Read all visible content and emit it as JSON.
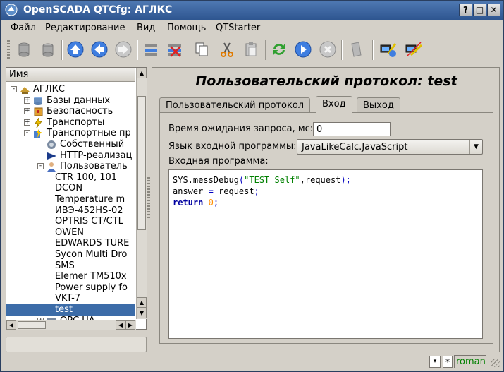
{
  "window": {
    "title": "OpenSCADA QTCfg: АГЛКС",
    "btn_help": "?",
    "btn_minimize": "_",
    "btn_maximize": "□",
    "btn_close": "✕"
  },
  "menu": [
    {
      "label": "Файл",
      "key": "F"
    },
    {
      "label": "Редактирование",
      "key": "Р"
    },
    {
      "label": "Вид",
      "key": "В"
    },
    {
      "label": "Помощь",
      "key": "П"
    },
    {
      "label": "QTStarter",
      "key": ""
    }
  ],
  "toolbar": {
    "icons": [
      "db-load-icon",
      "db-save-icon",
      "up-icon",
      "back-icon",
      "forward-icon",
      "add-item-icon",
      "delete-item-icon",
      "copy-icon",
      "cut-icon",
      "paste-icon",
      "refresh-icon",
      "start-icon",
      "stop-icon",
      "info-icon",
      "station-1-icon",
      "station-2-icon"
    ]
  },
  "tree": {
    "header": "Имя",
    "items": [
      {
        "label": "АГЛКС",
        "level": 0,
        "expander": "-",
        "icon": "station"
      },
      {
        "label": "Базы данных",
        "level": 1,
        "expander": "+",
        "icon": "db"
      },
      {
        "label": "Безопасность",
        "level": 1,
        "expander": "+",
        "icon": "security"
      },
      {
        "label": "Транспорты",
        "level": 1,
        "expander": "+",
        "icon": "transport"
      },
      {
        "label": "Транспортные пр",
        "level": 1,
        "expander": "-",
        "icon": "protocols"
      },
      {
        "label": "Собственный",
        "level": 2,
        "expander": "",
        "icon": "self"
      },
      {
        "label": "HTTP-реализац",
        "level": 2,
        "expander": "",
        "icon": "http"
      },
      {
        "label": "Пользователь",
        "level": 2,
        "expander": "-",
        "icon": "user"
      },
      {
        "label": "CTR 100, 101",
        "level": 3,
        "expander": "",
        "icon": ""
      },
      {
        "label": "DCON",
        "level": 3,
        "expander": "",
        "icon": ""
      },
      {
        "label": "Temperature m",
        "level": 3,
        "expander": "",
        "icon": ""
      },
      {
        "label": "ИВЭ-452HS-02",
        "level": 3,
        "expander": "",
        "icon": ""
      },
      {
        "label": "OPTRIS CT/CTL",
        "level": 3,
        "expander": "",
        "icon": ""
      },
      {
        "label": "OWEN",
        "level": 3,
        "expander": "",
        "icon": ""
      },
      {
        "label": "EDWARDS TURE",
        "level": 3,
        "expander": "",
        "icon": ""
      },
      {
        "label": "Sycon Multi Dro",
        "level": 3,
        "expander": "",
        "icon": ""
      },
      {
        "label": "SMS",
        "level": 3,
        "expander": "",
        "icon": ""
      },
      {
        "label": "Elemer TM510x",
        "level": 3,
        "expander": "",
        "icon": ""
      },
      {
        "label": "Power supply fo",
        "level": 3,
        "expander": "",
        "icon": ""
      },
      {
        "label": "VKT-7",
        "level": 3,
        "expander": "",
        "icon": ""
      },
      {
        "label": "test",
        "level": 3,
        "expander": "",
        "icon": "",
        "selected": true
      },
      {
        "label": "OPC UA",
        "level": 2,
        "expander": "+",
        "icon": "opc"
      }
    ]
  },
  "page": {
    "title": "Пользовательский протокол: test",
    "tabs": [
      {
        "label": "Пользовательский протокол",
        "active": false
      },
      {
        "label": "Вход",
        "active": true
      },
      {
        "label": "Выход",
        "active": false
      }
    ],
    "wait_label": "Время ожидания запроса, мс:",
    "wait_value": "0",
    "lang_label": "Язык входной программы:",
    "lang_value": "JavaLikeCalc.JavaScript",
    "program_label": "Входная программа:"
  },
  "program_code": [
    [
      {
        "t": "SYS.messDebug",
        "c": ""
      },
      {
        "t": "(",
        "c": "op"
      },
      {
        "t": "\"TEST Self\"",
        "c": "str"
      },
      {
        "t": ",request",
        "c": ""
      },
      {
        "t": ");",
        "c": "op"
      }
    ],
    [
      {
        "t": "answer ",
        "c": ""
      },
      {
        "t": "=",
        "c": "op"
      },
      {
        "t": " request",
        "c": ""
      },
      {
        "t": ";",
        "c": "op"
      }
    ],
    [
      {
        "t": "return",
        "c": "kw"
      },
      {
        "t": " ",
        "c": ""
      },
      {
        "t": "0",
        "c": "num"
      },
      {
        "t": ";",
        "c": "op"
      }
    ]
  ],
  "status": {
    "dropdown": "▾",
    "modified": "*",
    "user": "roman"
  },
  "colors": {
    "titlebar": "#2e5590",
    "selection": "#3c6ca8",
    "user": "#008000"
  }
}
